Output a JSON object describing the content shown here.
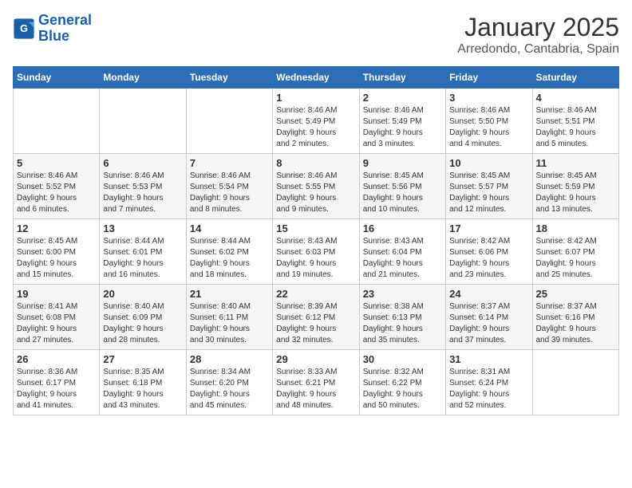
{
  "header": {
    "logo_line1": "General",
    "logo_line2": "Blue",
    "title": "January 2025",
    "subtitle": "Arredondo, Cantabria, Spain"
  },
  "weekdays": [
    "Sunday",
    "Monday",
    "Tuesday",
    "Wednesday",
    "Thursday",
    "Friday",
    "Saturday"
  ],
  "weeks": [
    [
      {
        "day": "",
        "info": ""
      },
      {
        "day": "",
        "info": ""
      },
      {
        "day": "",
        "info": ""
      },
      {
        "day": "1",
        "info": "Sunrise: 8:46 AM\nSunset: 5:49 PM\nDaylight: 9 hours\nand 2 minutes."
      },
      {
        "day": "2",
        "info": "Sunrise: 8:46 AM\nSunset: 5:49 PM\nDaylight: 9 hours\nand 3 minutes."
      },
      {
        "day": "3",
        "info": "Sunrise: 8:46 AM\nSunset: 5:50 PM\nDaylight: 9 hours\nand 4 minutes."
      },
      {
        "day": "4",
        "info": "Sunrise: 8:46 AM\nSunset: 5:51 PM\nDaylight: 9 hours\nand 5 minutes."
      }
    ],
    [
      {
        "day": "5",
        "info": "Sunrise: 8:46 AM\nSunset: 5:52 PM\nDaylight: 9 hours\nand 6 minutes."
      },
      {
        "day": "6",
        "info": "Sunrise: 8:46 AM\nSunset: 5:53 PM\nDaylight: 9 hours\nand 7 minutes."
      },
      {
        "day": "7",
        "info": "Sunrise: 8:46 AM\nSunset: 5:54 PM\nDaylight: 9 hours\nand 8 minutes."
      },
      {
        "day": "8",
        "info": "Sunrise: 8:46 AM\nSunset: 5:55 PM\nDaylight: 9 hours\nand 9 minutes."
      },
      {
        "day": "9",
        "info": "Sunrise: 8:45 AM\nSunset: 5:56 PM\nDaylight: 9 hours\nand 10 minutes."
      },
      {
        "day": "10",
        "info": "Sunrise: 8:45 AM\nSunset: 5:57 PM\nDaylight: 9 hours\nand 12 minutes."
      },
      {
        "day": "11",
        "info": "Sunrise: 8:45 AM\nSunset: 5:59 PM\nDaylight: 9 hours\nand 13 minutes."
      }
    ],
    [
      {
        "day": "12",
        "info": "Sunrise: 8:45 AM\nSunset: 6:00 PM\nDaylight: 9 hours\nand 15 minutes."
      },
      {
        "day": "13",
        "info": "Sunrise: 8:44 AM\nSunset: 6:01 PM\nDaylight: 9 hours\nand 16 minutes."
      },
      {
        "day": "14",
        "info": "Sunrise: 8:44 AM\nSunset: 6:02 PM\nDaylight: 9 hours\nand 18 minutes."
      },
      {
        "day": "15",
        "info": "Sunrise: 8:43 AM\nSunset: 6:03 PM\nDaylight: 9 hours\nand 19 minutes."
      },
      {
        "day": "16",
        "info": "Sunrise: 8:43 AM\nSunset: 6:04 PM\nDaylight: 9 hours\nand 21 minutes."
      },
      {
        "day": "17",
        "info": "Sunrise: 8:42 AM\nSunset: 6:06 PM\nDaylight: 9 hours\nand 23 minutes."
      },
      {
        "day": "18",
        "info": "Sunrise: 8:42 AM\nSunset: 6:07 PM\nDaylight: 9 hours\nand 25 minutes."
      }
    ],
    [
      {
        "day": "19",
        "info": "Sunrise: 8:41 AM\nSunset: 6:08 PM\nDaylight: 9 hours\nand 27 minutes."
      },
      {
        "day": "20",
        "info": "Sunrise: 8:40 AM\nSunset: 6:09 PM\nDaylight: 9 hours\nand 28 minutes."
      },
      {
        "day": "21",
        "info": "Sunrise: 8:40 AM\nSunset: 6:11 PM\nDaylight: 9 hours\nand 30 minutes."
      },
      {
        "day": "22",
        "info": "Sunrise: 8:39 AM\nSunset: 6:12 PM\nDaylight: 9 hours\nand 32 minutes."
      },
      {
        "day": "23",
        "info": "Sunrise: 8:38 AM\nSunset: 6:13 PM\nDaylight: 9 hours\nand 35 minutes."
      },
      {
        "day": "24",
        "info": "Sunrise: 8:37 AM\nSunset: 6:14 PM\nDaylight: 9 hours\nand 37 minutes."
      },
      {
        "day": "25",
        "info": "Sunrise: 8:37 AM\nSunset: 6:16 PM\nDaylight: 9 hours\nand 39 minutes."
      }
    ],
    [
      {
        "day": "26",
        "info": "Sunrise: 8:36 AM\nSunset: 6:17 PM\nDaylight: 9 hours\nand 41 minutes."
      },
      {
        "day": "27",
        "info": "Sunrise: 8:35 AM\nSunset: 6:18 PM\nDaylight: 9 hours\nand 43 minutes."
      },
      {
        "day": "28",
        "info": "Sunrise: 8:34 AM\nSunset: 6:20 PM\nDaylight: 9 hours\nand 45 minutes."
      },
      {
        "day": "29",
        "info": "Sunrise: 8:33 AM\nSunset: 6:21 PM\nDaylight: 9 hours\nand 48 minutes."
      },
      {
        "day": "30",
        "info": "Sunrise: 8:32 AM\nSunset: 6:22 PM\nDaylight: 9 hours\nand 50 minutes."
      },
      {
        "day": "31",
        "info": "Sunrise: 8:31 AM\nSunset: 6:24 PM\nDaylight: 9 hours\nand 52 minutes."
      },
      {
        "day": "",
        "info": ""
      }
    ]
  ]
}
